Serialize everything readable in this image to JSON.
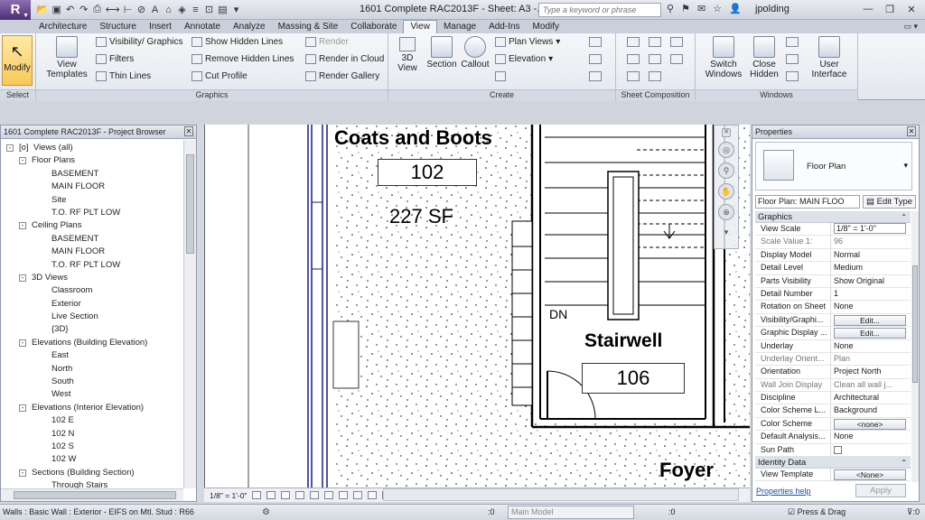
{
  "title_bar": {
    "logo": "R",
    "document_title": "1601 Complete RAC2013F - Sheet: A3 -...",
    "search_placeholder": "Type a keyword or phrase",
    "user": "jpolding"
  },
  "ribbon": {
    "tabs": [
      "Architecture",
      "Structure",
      "Insert",
      "Annotate",
      "Analyze",
      "Massing & Site",
      "Collaborate",
      "View",
      "Manage",
      "Add-Ins",
      "Modify"
    ],
    "active_tab": "View",
    "select_panel": {
      "modify": "Modify",
      "label": "Select"
    },
    "graphics_panel": {
      "view_templates": [
        "View",
        "Templates"
      ],
      "visibility_graphics": "Visibility/ Graphics",
      "filters": "Filters",
      "thin_lines": "Thin Lines",
      "show_hidden_lines": "Show Hidden Lines",
      "remove_hidden_lines": "Remove Hidden Lines",
      "cut_profile": "Cut Profile",
      "render": "Render",
      "render_in_cloud": "Render in Cloud",
      "render_gallery": "Render Gallery",
      "label": "Graphics"
    },
    "create_panel": {
      "view_3d": [
        "3D",
        "View"
      ],
      "section": "Section",
      "callout": "Callout",
      "plan_views": "Plan Views",
      "elevation": "Elevation",
      "label": "Create"
    },
    "sheet_panel": {
      "label": "Sheet Composition"
    },
    "windows_panel": {
      "switch_windows": [
        "Switch",
        "Windows"
      ],
      "close_hidden": [
        "Close",
        "Hidden"
      ],
      "user_interface": [
        "User",
        "Interface"
      ],
      "label": "Windows"
    }
  },
  "project_browser": {
    "title": "1601 Complete RAC2013F - Project Browser",
    "items": [
      {
        "label": "Views (all)",
        "level": 0,
        "toggle": "-",
        "icon": "[o]"
      },
      {
        "label": "Floor Plans",
        "level": 1,
        "toggle": "-"
      },
      {
        "label": "BASEMENT",
        "level": 2
      },
      {
        "label": "MAIN FLOOR",
        "level": 2
      },
      {
        "label": "Site",
        "level": 2
      },
      {
        "label": "T.O. RF PLT LOW",
        "level": 2
      },
      {
        "label": "Ceiling Plans",
        "level": 1,
        "toggle": "-"
      },
      {
        "label": "BASEMENT",
        "level": 2
      },
      {
        "label": "MAIN FLOOR",
        "level": 2
      },
      {
        "label": "T.O. RF PLT LOW",
        "level": 2
      },
      {
        "label": "3D Views",
        "level": 1,
        "toggle": "-"
      },
      {
        "label": "Classroom",
        "level": 2
      },
      {
        "label": "Exterior",
        "level": 2
      },
      {
        "label": "Live Section",
        "level": 2
      },
      {
        "label": "{3D}",
        "level": 2
      },
      {
        "label": "Elevations (Building Elevation)",
        "level": 1,
        "toggle": "-"
      },
      {
        "label": "East",
        "level": 2
      },
      {
        "label": "North",
        "level": 2
      },
      {
        "label": "South",
        "level": 2
      },
      {
        "label": "West",
        "level": 2
      },
      {
        "label": "Elevations (Interior Elevation)",
        "level": 1,
        "toggle": "-"
      },
      {
        "label": "102 E",
        "level": 2
      },
      {
        "label": "102 N",
        "level": 2
      },
      {
        "label": "102 S",
        "level": 2
      },
      {
        "label": "102 W",
        "level": 2
      },
      {
        "label": "Sections (Building Section)",
        "level": 1,
        "toggle": "-"
      },
      {
        "label": "Through Stairs",
        "level": 2
      }
    ]
  },
  "canvas": {
    "room_102_name": "Coats and Boots",
    "room_102_number": "102",
    "room_102_area": "227 SF",
    "stair_dn": "DN",
    "room_106_name": "Stairwell",
    "room_106_number": "106",
    "foyer_name": "Foyer"
  },
  "view_control_bar": {
    "scale": "1/8\" = 1'-0\""
  },
  "properties": {
    "title": "Properties",
    "type_name": "Floor Plan",
    "instance_selector": "Floor Plan: MAIN FLOO",
    "edit_type": "Edit Type",
    "groups": [
      {
        "name": "Graphics",
        "rows": [
          {
            "name": "View Scale",
            "value": "1/8\" = 1'-0\"",
            "style": "boxed"
          },
          {
            "name": "Scale Value    1:",
            "value": "96",
            "style": "ro"
          },
          {
            "name": "Display Model",
            "value": "Normal"
          },
          {
            "name": "Detail Level",
            "value": "Medium"
          },
          {
            "name": "Parts Visibility",
            "value": "Show Original"
          },
          {
            "name": "Detail Number",
            "value": "1"
          },
          {
            "name": "Rotation on Sheet",
            "value": "None"
          },
          {
            "name": "Visibility/Graphi...",
            "value": "Edit...",
            "style": "button"
          },
          {
            "name": "Graphic Display ...",
            "value": "Edit...",
            "style": "button"
          },
          {
            "name": "Underlay",
            "value": "None"
          },
          {
            "name": "Underlay Orient...",
            "value": "Plan",
            "style": "ro"
          },
          {
            "name": "Orientation",
            "value": "Project North"
          },
          {
            "name": "Wall Join Display",
            "value": "Clean all wall j...",
            "style": "ro"
          },
          {
            "name": "Discipline",
            "value": "Architectural"
          },
          {
            "name": "Color Scheme L...",
            "value": "Background"
          },
          {
            "name": "Color Scheme",
            "value": "<none>",
            "style": "button"
          },
          {
            "name": "Default Analysis...",
            "value": "None"
          },
          {
            "name": "Sun Path",
            "value": "",
            "style": "check"
          }
        ]
      },
      {
        "name": "Identity Data",
        "rows": [
          {
            "name": "View Template",
            "value": "<None>",
            "style": "button"
          }
        ]
      }
    ],
    "help_link": "Properties help",
    "apply": "Apply"
  },
  "status_bar": {
    "message": "Walls : Basic Wall : Exterior - EIFS on Mtl. Stud : R66",
    "zero_a": ":0",
    "model": "Main Model",
    "zero_b": ":0",
    "press_drag": "Press & Drag",
    "filter": ":0"
  }
}
